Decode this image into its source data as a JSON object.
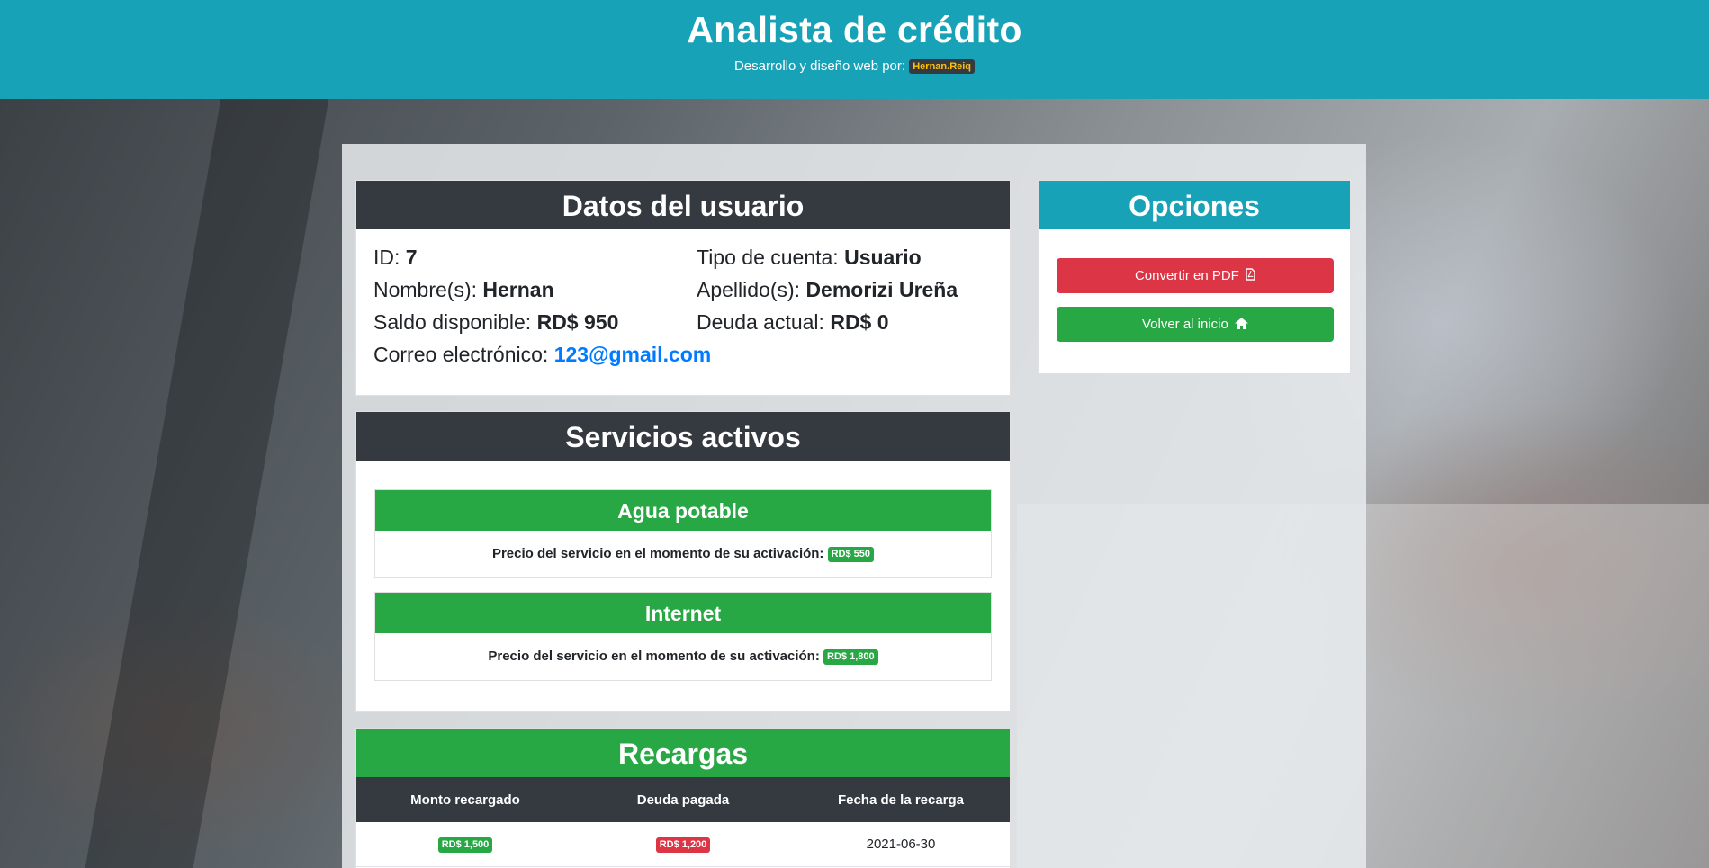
{
  "header": {
    "title": "Analista de crédito",
    "subtitle": "Desarrollo y diseño web por:",
    "brand": "Hernan.Reiq"
  },
  "user_card": {
    "title": "Datos del usuario",
    "id_label": "ID:",
    "id_value": "7",
    "account_type_label": "Tipo de cuenta:",
    "account_type_value": "Usuario",
    "name_label": "Nombre(s):",
    "name_value": "Hernan",
    "surname_label": "Apellido(s):",
    "surname_value": "Demorizi Ureña",
    "balance_label": "Saldo disponible:",
    "balance_value": "RD$ 950",
    "debt_label": "Deuda actual:",
    "debt_value": "RD$ 0",
    "email_label": "Correo electrónico:",
    "email_value": "123@gmail.com"
  },
  "options_card": {
    "title": "Opciones",
    "pdf_button": "Convertir en PDF",
    "home_button": "Volver al inicio",
    "pdf_icon": "file-pdf-icon",
    "home_icon": "home-icon"
  },
  "services_card": {
    "title": "Servicios activos",
    "price_label": "Precio del servicio en el momento de su activación:",
    "items": [
      {
        "name": "Agua potable",
        "price": "RD$ 550"
      },
      {
        "name": "Internet",
        "price": "RD$ 1,800"
      }
    ]
  },
  "recharges_card": {
    "title": "Recargas",
    "columns": [
      "Monto recargado",
      "Deuda pagada",
      "Fecha de la recarga"
    ],
    "rows": [
      {
        "amount": "RD$ 1,500",
        "debt_paid": "RD$ 1,200",
        "date": "2021-06-30"
      }
    ]
  },
  "colors": {
    "header": "#17a2b8",
    "dark": "#343a40",
    "success": "#28a745",
    "danger": "#dc3545",
    "link": "#007bff",
    "brand_text": "#ffc107"
  }
}
